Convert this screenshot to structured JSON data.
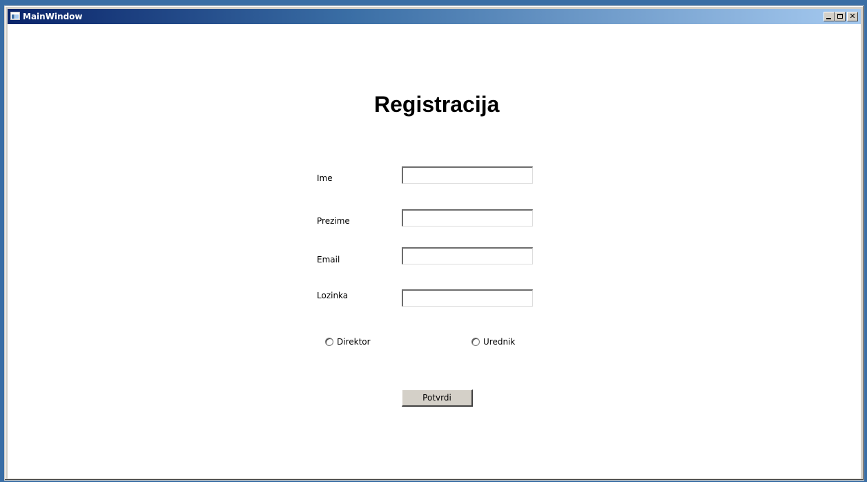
{
  "window": {
    "title": "MainWindow",
    "controls": {
      "minimize": "minimize-icon",
      "maximize": "maximize-icon",
      "close": "close-icon"
    }
  },
  "form": {
    "heading": "Registracija",
    "fields": [
      {
        "label": "Ime",
        "value": "",
        "placeholder": ""
      },
      {
        "label": "Prezime",
        "value": "",
        "placeholder": ""
      },
      {
        "label": "Email",
        "value": "",
        "placeholder": ""
      },
      {
        "label": "Lozinka",
        "value": "",
        "placeholder": ""
      }
    ],
    "roles": [
      {
        "label": "Direktor",
        "checked": false
      },
      {
        "label": "Urednik",
        "checked": false
      }
    ],
    "submit_label": "Potvrdi"
  },
  "colors": {
    "titlebar_start": "#0a246a",
    "titlebar_end": "#a6caf0",
    "client_bg": "#ffffff",
    "button_face": "#d4d0c8",
    "desktop": "#3a6ea5"
  }
}
